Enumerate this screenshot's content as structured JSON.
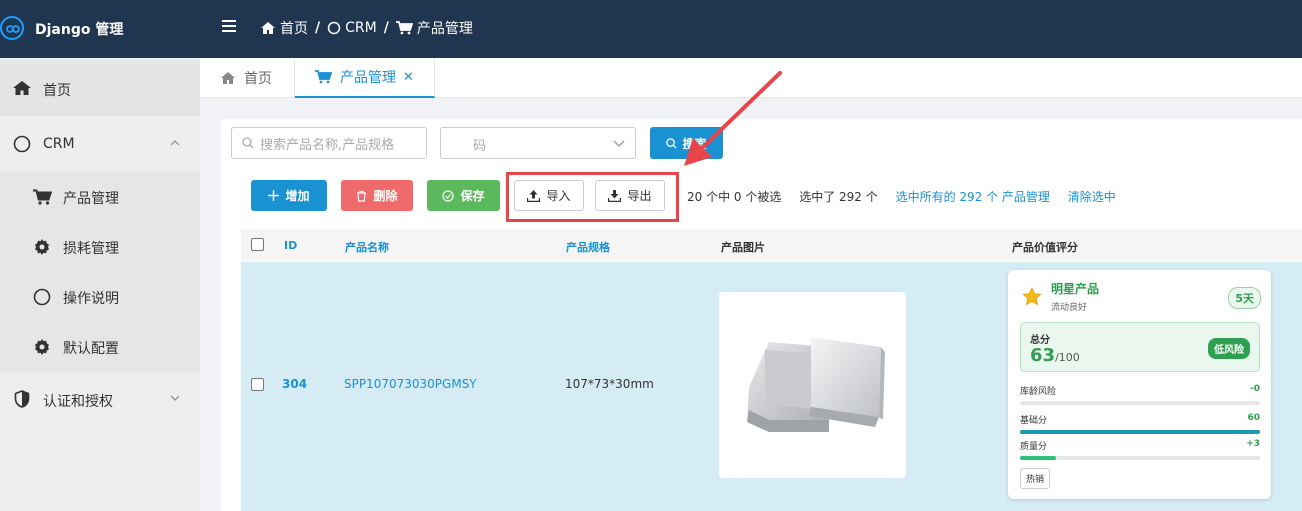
{
  "brand": {
    "title": "Django 管理"
  },
  "breadcrumb": {
    "home": "首页",
    "crm": "CRM",
    "current": "产品管理",
    "sep": "/"
  },
  "sidebar": {
    "items": [
      {
        "label": "首页"
      },
      {
        "label": "CRM"
      },
      {
        "label": "产品管理"
      },
      {
        "label": "损耗管理"
      },
      {
        "label": "操作说明"
      },
      {
        "label": "默认配置"
      },
      {
        "label": "认证和授权"
      }
    ]
  },
  "tabs": [
    {
      "label": "首页"
    },
    {
      "label": "产品管理",
      "close": "✕"
    }
  ],
  "search": {
    "placeholder": "搜索产品名称,产品规格",
    "select_value": "码",
    "button": "搜索"
  },
  "toolbar": {
    "add": "增加",
    "delete": "删除",
    "save": "保存",
    "import": "导入",
    "export": "导出"
  },
  "selection": {
    "count": "20 个中 0 个被选",
    "selected": "选中了 292 个",
    "select_all": "选中所有的 292 个 产品管理",
    "clear": "清除选中"
  },
  "table": {
    "headers": {
      "id": "ID",
      "name": "产品名称",
      "spec": "产品规格",
      "image": "产品图片",
      "score": "产品价值评分"
    },
    "rows": [
      {
        "id": "304",
        "name": "SPP107073030PGMSY",
        "spec": "107*73*30mm"
      }
    ]
  },
  "score_card": {
    "title": "明星产品",
    "subtitle": "流动良好",
    "days": "5天",
    "total_label": "总分",
    "total_value": "63",
    "total_max": "/100",
    "risk": "低风险",
    "metrics": [
      {
        "label": "库龄风险",
        "value": "-0",
        "level": 0.0
      },
      {
        "label": "基础分",
        "value": "60",
        "level": 1.0
      },
      {
        "label": "质量分",
        "value": "+3",
        "level": 0.15
      }
    ],
    "tag": "热销"
  },
  "colors": {
    "topbar": "#1f3550",
    "accent": "#1a91d0",
    "danger": "#ef6b6b",
    "success": "#5cb85c",
    "highlight": "#e8454a",
    "row_selected": "#d6ecf5"
  },
  "icons": {
    "brand": "infinity-logo-icon",
    "menu": "hamburger-icon",
    "home": "home-icon",
    "circle": "circle-icon",
    "cart": "cart-icon",
    "gear": "gear-icon",
    "shield": "shield-icon",
    "search": "search-icon",
    "upload": "upload-icon",
    "download": "download-icon",
    "star": "star-icon"
  }
}
